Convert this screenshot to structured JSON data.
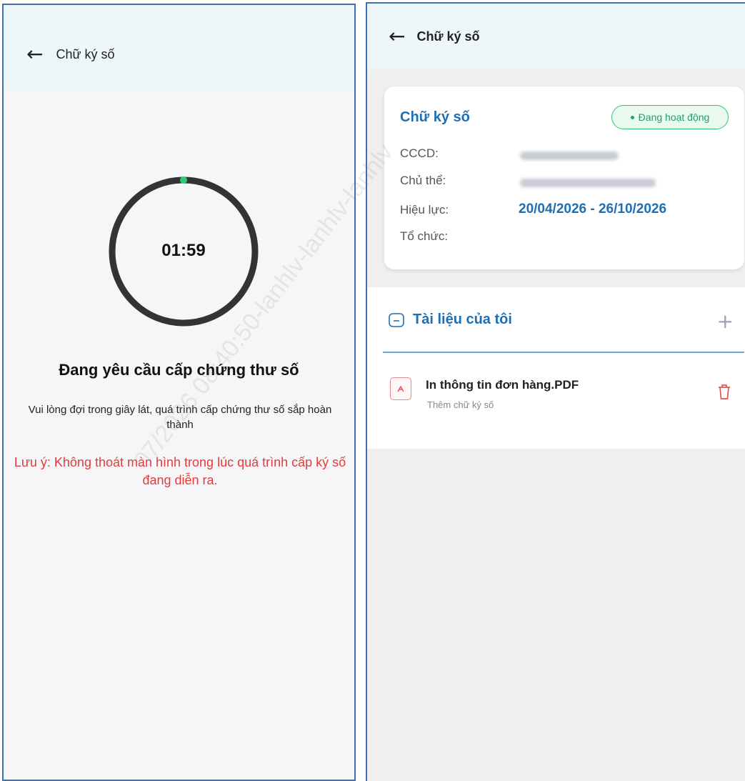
{
  "left_screen": {
    "header": {
      "title": "Chữ ký số"
    },
    "timer": {
      "value": "01:59",
      "ring_color": "#333333",
      "indicator_color": "#2ecc71"
    },
    "heading": "Đang yêu cầu cấp chứng thư số",
    "description": "Vui lòng đợi trong giây lát, quá trình cấp chứng thư số sắp hoàn thành",
    "warning": "Lưu ý: Không thoát màn hình trong lúc quá trình cấp ký số đang diễn ra."
  },
  "right_screen": {
    "header": {
      "title": "Chữ ký số"
    },
    "card": {
      "title": "Chữ ký số",
      "status": "Đang hoạt động",
      "fields": [
        {
          "label": "CCCD:"
        },
        {
          "label": "Chủ thể:"
        },
        {
          "label": "Hiệu lực:",
          "value": "20/04/2026 - 26/10/2026"
        },
        {
          "label": "Tổ chức:"
        }
      ]
    },
    "documents": {
      "title": "Tài liệu của tôi",
      "items": [
        {
          "name": "In thông tin đơn hàng.PDF",
          "action": "Thêm chữ ký số"
        }
      ]
    }
  },
  "watermark": "07/2026 08:40:50-lanhlv-lanhlv-lanhlv",
  "colors": {
    "accent": "#1d6fb6",
    "warning": "#e53b3b",
    "status": "#24a063"
  }
}
